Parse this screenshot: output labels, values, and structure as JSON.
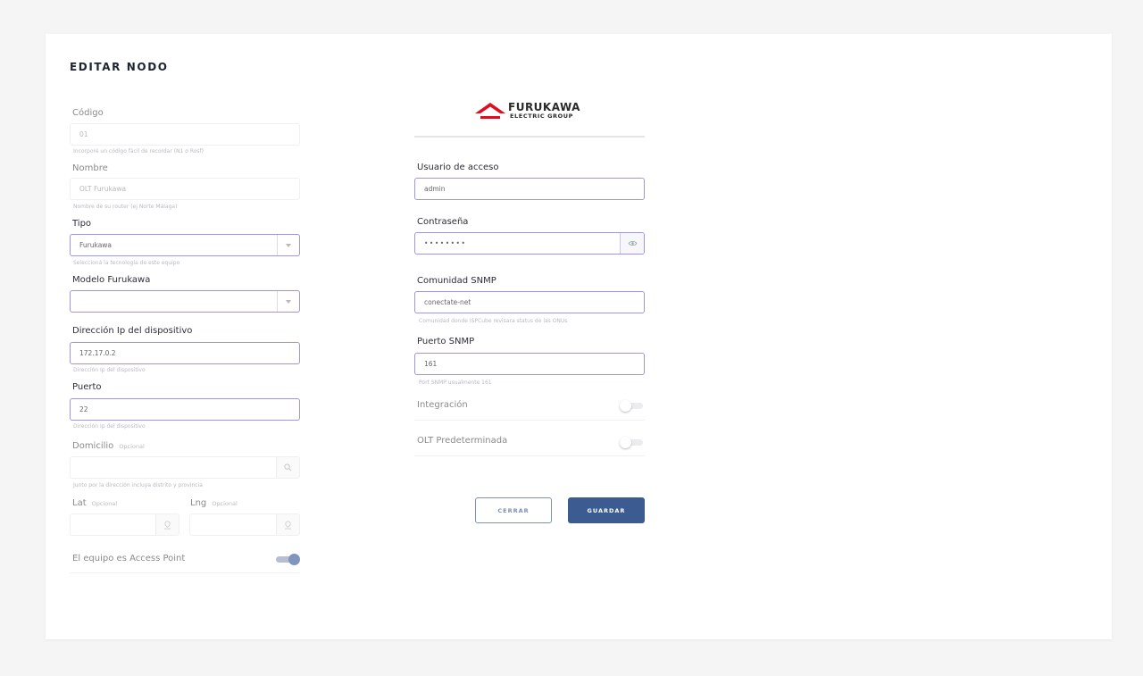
{
  "page": {
    "title": "EDITAR NODO"
  },
  "brand": {
    "logo_main": "FURUKAWA",
    "logo_sub": "ELECTRIC GROUP",
    "logo_color": "#e30b21"
  },
  "left": {
    "codigo": {
      "label": "Código",
      "value": "01",
      "help": "Incorporé un código fácil de recordar (N1 o Rosf)"
    },
    "nombre": {
      "label": "Nombre",
      "value": "OLT Furukawa",
      "help": "Nombre de su router (ej Norte Málaga)"
    },
    "tipo": {
      "label": "Tipo",
      "value": "Furukawa",
      "help": "Seleccioná la tecnología de este equipo"
    },
    "modelo": {
      "label": "Modelo Furukawa",
      "value": ""
    },
    "ip": {
      "label": "Dirección Ip del dispositivo",
      "value": "172.17.0.2",
      "help": "Dirección Ip del dispositivo"
    },
    "puerto": {
      "label": "Puerto",
      "value": "22",
      "help": "Dirección Ip del dispositivo"
    },
    "domicilio": {
      "label": "Domicilio",
      "optional": "Opcional",
      "value": "",
      "help": "Junto por la dirección incluya distrito y provincia"
    },
    "lat": {
      "label": "Lat",
      "optional": "Opcional",
      "value": ""
    },
    "lng": {
      "label": "Lng",
      "optional": "Opcional",
      "value": ""
    },
    "access_point": {
      "label": "El equipo es Access Point",
      "on": true
    }
  },
  "right": {
    "usuario": {
      "label": "Usuario de acceso",
      "value": "admin"
    },
    "contrasena": {
      "label": "Contraseña",
      "value": "••••••••"
    },
    "comunidad": {
      "label": "Comunidad SNMP",
      "value": "conectate-net",
      "help": "Comunidad donde ISPCube revisara status de las ONUs"
    },
    "puerto_snmp": {
      "label": "Puerto SNMP",
      "value": "161",
      "help": "Port SNMP usualmente 161"
    },
    "integracion": {
      "label": "Integración",
      "on": false
    },
    "olt_predeterminada": {
      "label": "OLT Predeterminada",
      "on": false
    }
  },
  "actions": {
    "cancel": "CERRAR",
    "save": "GUARDAR"
  },
  "colors": {
    "accent": "#3c5b91",
    "input_border": "#9c97e0",
    "background": "#f5f5f5"
  }
}
